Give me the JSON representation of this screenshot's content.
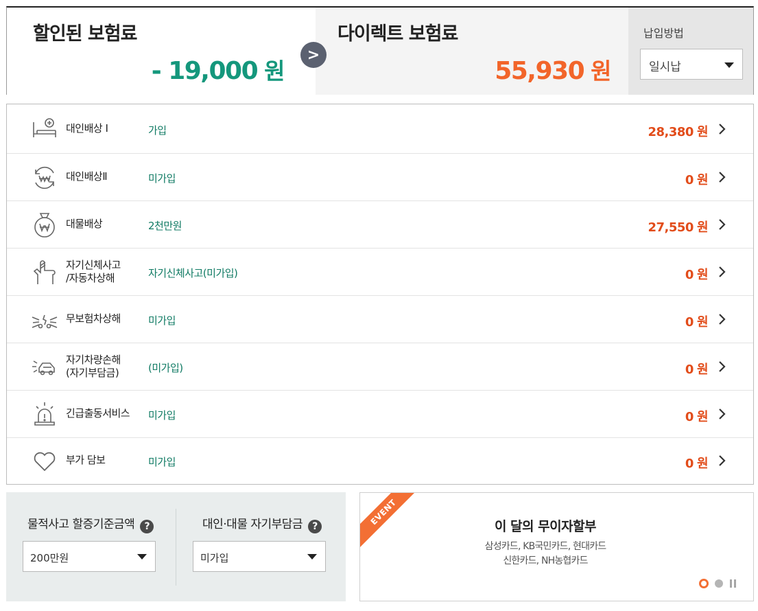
{
  "summary": {
    "discount_title": "할인된 보험료",
    "discount_amount": "- 19,000",
    "discount_unit": "원",
    "direct_title": "다이렉트 보험료",
    "direct_amount": "55,930",
    "direct_unit": "원",
    "arrow_glyph": ">",
    "payment_label": "납입방법",
    "payment_value": "일시납"
  },
  "coverages": [
    {
      "icon": "bed-icon",
      "name": "대인배상 Ⅰ",
      "status": "가입",
      "amount": "28,380",
      "unit": "원"
    },
    {
      "icon": "won-cycle-icon",
      "name": "대인배상Ⅱ",
      "status": "미가입",
      "amount": "0",
      "unit": "원"
    },
    {
      "icon": "money-bag-icon",
      "name": "대물배상",
      "status": "2천만원",
      "amount": "27,550",
      "unit": "원"
    },
    {
      "icon": "bandaged-hand-icon",
      "name": "자기신체사고",
      "name2": "/자동차상해",
      "status": "자기신체사고(미가입)",
      "amount": "0",
      "unit": "원"
    },
    {
      "icon": "car-collision-icon",
      "name": "무보험차상해",
      "status": "미가입",
      "amount": "0",
      "unit": "원"
    },
    {
      "icon": "car-damage-icon",
      "name": "자기차량손해",
      "name2": "(자기부담금)",
      "status": "(미가입)",
      "amount": "0",
      "unit": "원"
    },
    {
      "icon": "emergency-light-icon",
      "name": "긴급출동서비스",
      "status": "미가입",
      "amount": "0",
      "unit": "원"
    },
    {
      "icon": "heart-icon",
      "name": "부가 담보",
      "status": "미가입",
      "amount": "0",
      "unit": "원"
    }
  ],
  "options": {
    "property_label": "물적사고 할증기준금액",
    "property_value": "200만원",
    "deductible_label": "대인·대물 자기부담금",
    "deductible_value": "미가입",
    "help_glyph": "?"
  },
  "event": {
    "badge": "EVENT",
    "title": "이 달의 무이자할부",
    "line1": "삼성카드, KB국민카드, 현대카드",
    "line2": "신한카드, NH농협카드"
  },
  "colors": {
    "discount": "#14977c",
    "direct": "#f2652a",
    "amount": "#e24c1a",
    "status": "#0f7a63",
    "event_accent": "#f36f34"
  }
}
